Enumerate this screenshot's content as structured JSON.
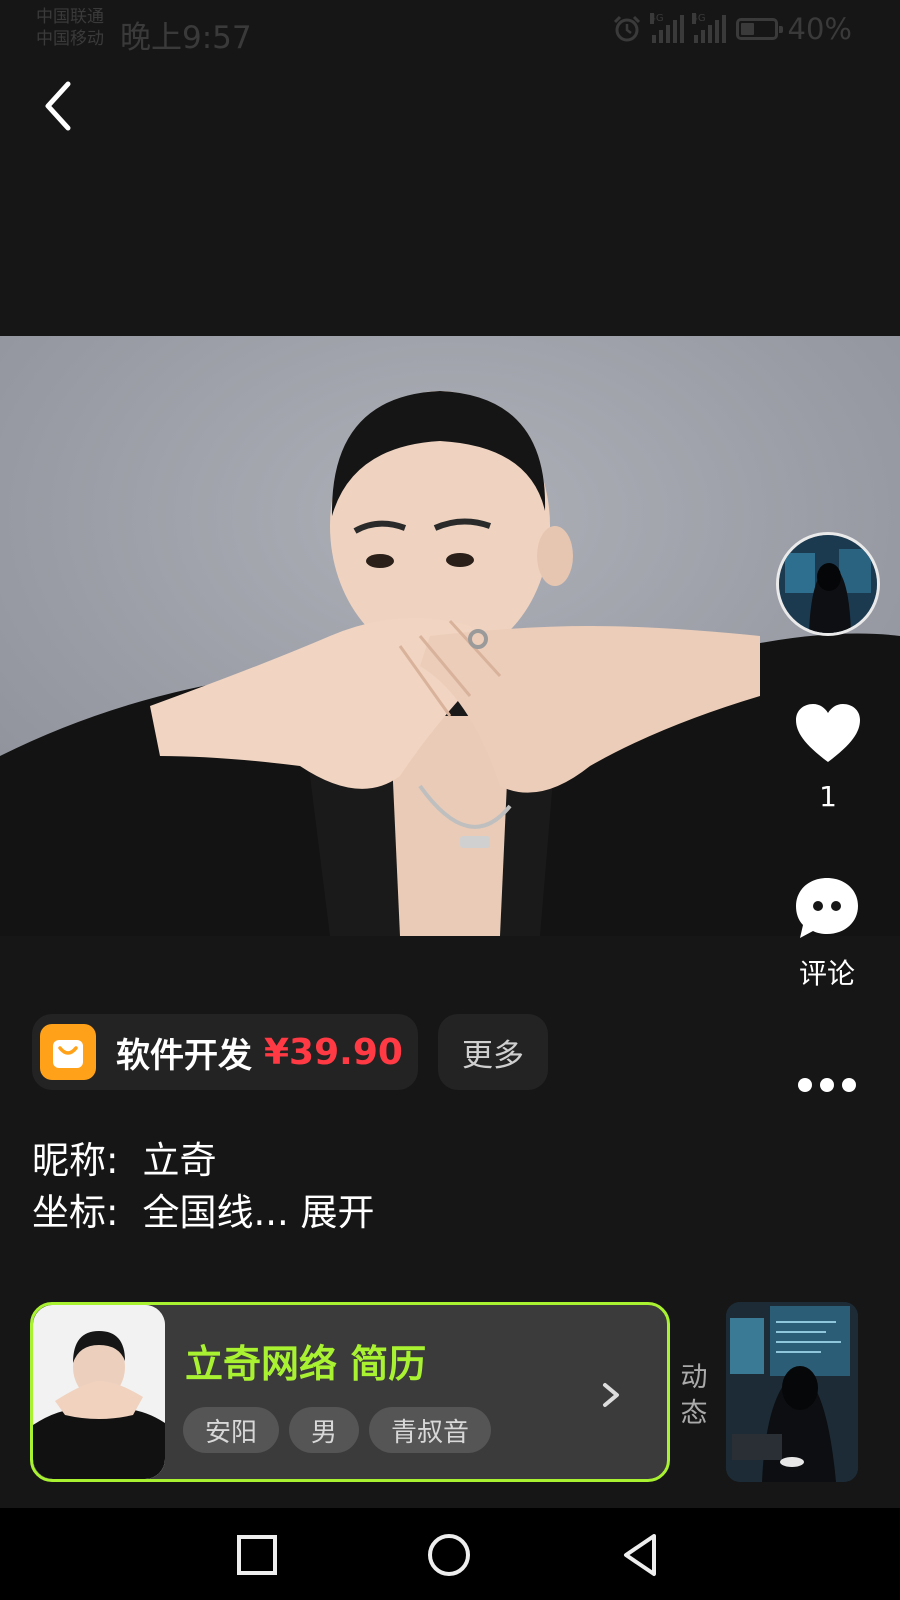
{
  "status_bar": {
    "carrier_1": "中国联通",
    "carrier_2": "中国移动",
    "time": "晚上9:57",
    "sim1_network": "4G",
    "sim2_network": "4G",
    "battery_percent": "40%",
    "battery_level": 0.4,
    "icons": [
      "alarm-icon",
      "signal-icon",
      "signal-icon",
      "battery-icon"
    ]
  },
  "nav": {
    "back_icon": "chevron-left-icon"
  },
  "rail": {
    "like_count": "1",
    "comment_label": "评论",
    "icons": [
      "avatar",
      "heart-icon",
      "comment-bubble-icon",
      "more-dots-icon"
    ]
  },
  "product": {
    "name": "软件开发",
    "price": "¥39.90",
    "more_label": "更多",
    "icon": "shopping-bag-icon",
    "accent": "#ffa21a",
    "price_color": "#ff3a44"
  },
  "info": {
    "nickname_label": "昵称:",
    "nickname_value": "立奇",
    "location_label": "坐标:",
    "location_value": "全国线... 展开"
  },
  "resume": {
    "title": "立奇网络 简历",
    "tags": [
      "安阳",
      "男",
      "青叔音"
    ],
    "accent": "#a9f231"
  },
  "dynamic": {
    "label": "动\n态"
  },
  "system_nav": {
    "icons": [
      "recent-apps-icon",
      "home-icon",
      "back-triangle-icon"
    ]
  }
}
